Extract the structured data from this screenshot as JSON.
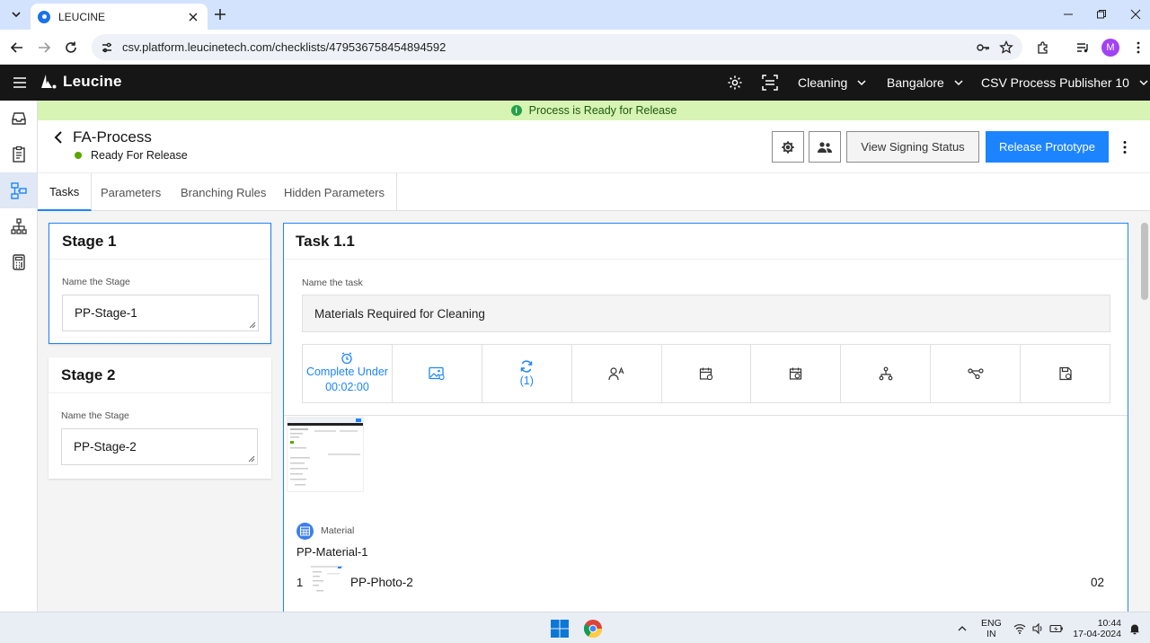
{
  "browser": {
    "tab_title": "LEUCINE",
    "url": "csv.platform.leucinetech.com/checklists/479536758454894592",
    "profile_initial": "M"
  },
  "app": {
    "logo_text": "Leucine",
    "facility": "Cleaning",
    "location": "Bangalore",
    "user_role": "CSV Process Publisher 10"
  },
  "banner": {
    "text": "Process is Ready for Release",
    "icon": "info-icon"
  },
  "process": {
    "title": "FA-Process",
    "status": "Ready For Release",
    "view_signing_label": "View Signing Status",
    "release_label": "Release Prototype"
  },
  "tabs": [
    {
      "label": "Tasks"
    },
    {
      "label": "Parameters"
    },
    {
      "label": "Branching Rules"
    },
    {
      "label": "Hidden Parameters"
    }
  ],
  "stages": [
    {
      "title": "Stage 1",
      "field_label": "Name the Stage",
      "value": "PP-Stage-1"
    },
    {
      "title": "Stage 2",
      "field_label": "Name the Stage",
      "value": "PP-Stage-2"
    }
  ],
  "task": {
    "title": "Task 1.1",
    "field_label": "Name the task",
    "value": "Materials Required for Cleaning",
    "timer_label": "Complete Under",
    "timer_value": "00:02:00",
    "recurrence_count": "(1)",
    "tool_icons": [
      "alarm-clock-icon",
      "image-icon",
      "refresh-icon",
      "user-assign-icon",
      "calendar-icon",
      "schedule-icon",
      "hierarchy-icon",
      "flow-icon",
      "save-doc-icon"
    ]
  },
  "material": {
    "type_label": "Material",
    "name": "PP-Material-1",
    "items": [
      {
        "index": "1",
        "name": "PP-Photo-2",
        "quantity": "02"
      }
    ]
  },
  "taskbar": {
    "lang_line1": "ENG",
    "lang_line2": "IN",
    "time": "10:44",
    "date": "17-04-2024"
  },
  "colors": {
    "accent": "#1d84ff",
    "header_bg": "#161616",
    "banner_bg": "#d7f4b4",
    "status_green": "#5aa700"
  }
}
